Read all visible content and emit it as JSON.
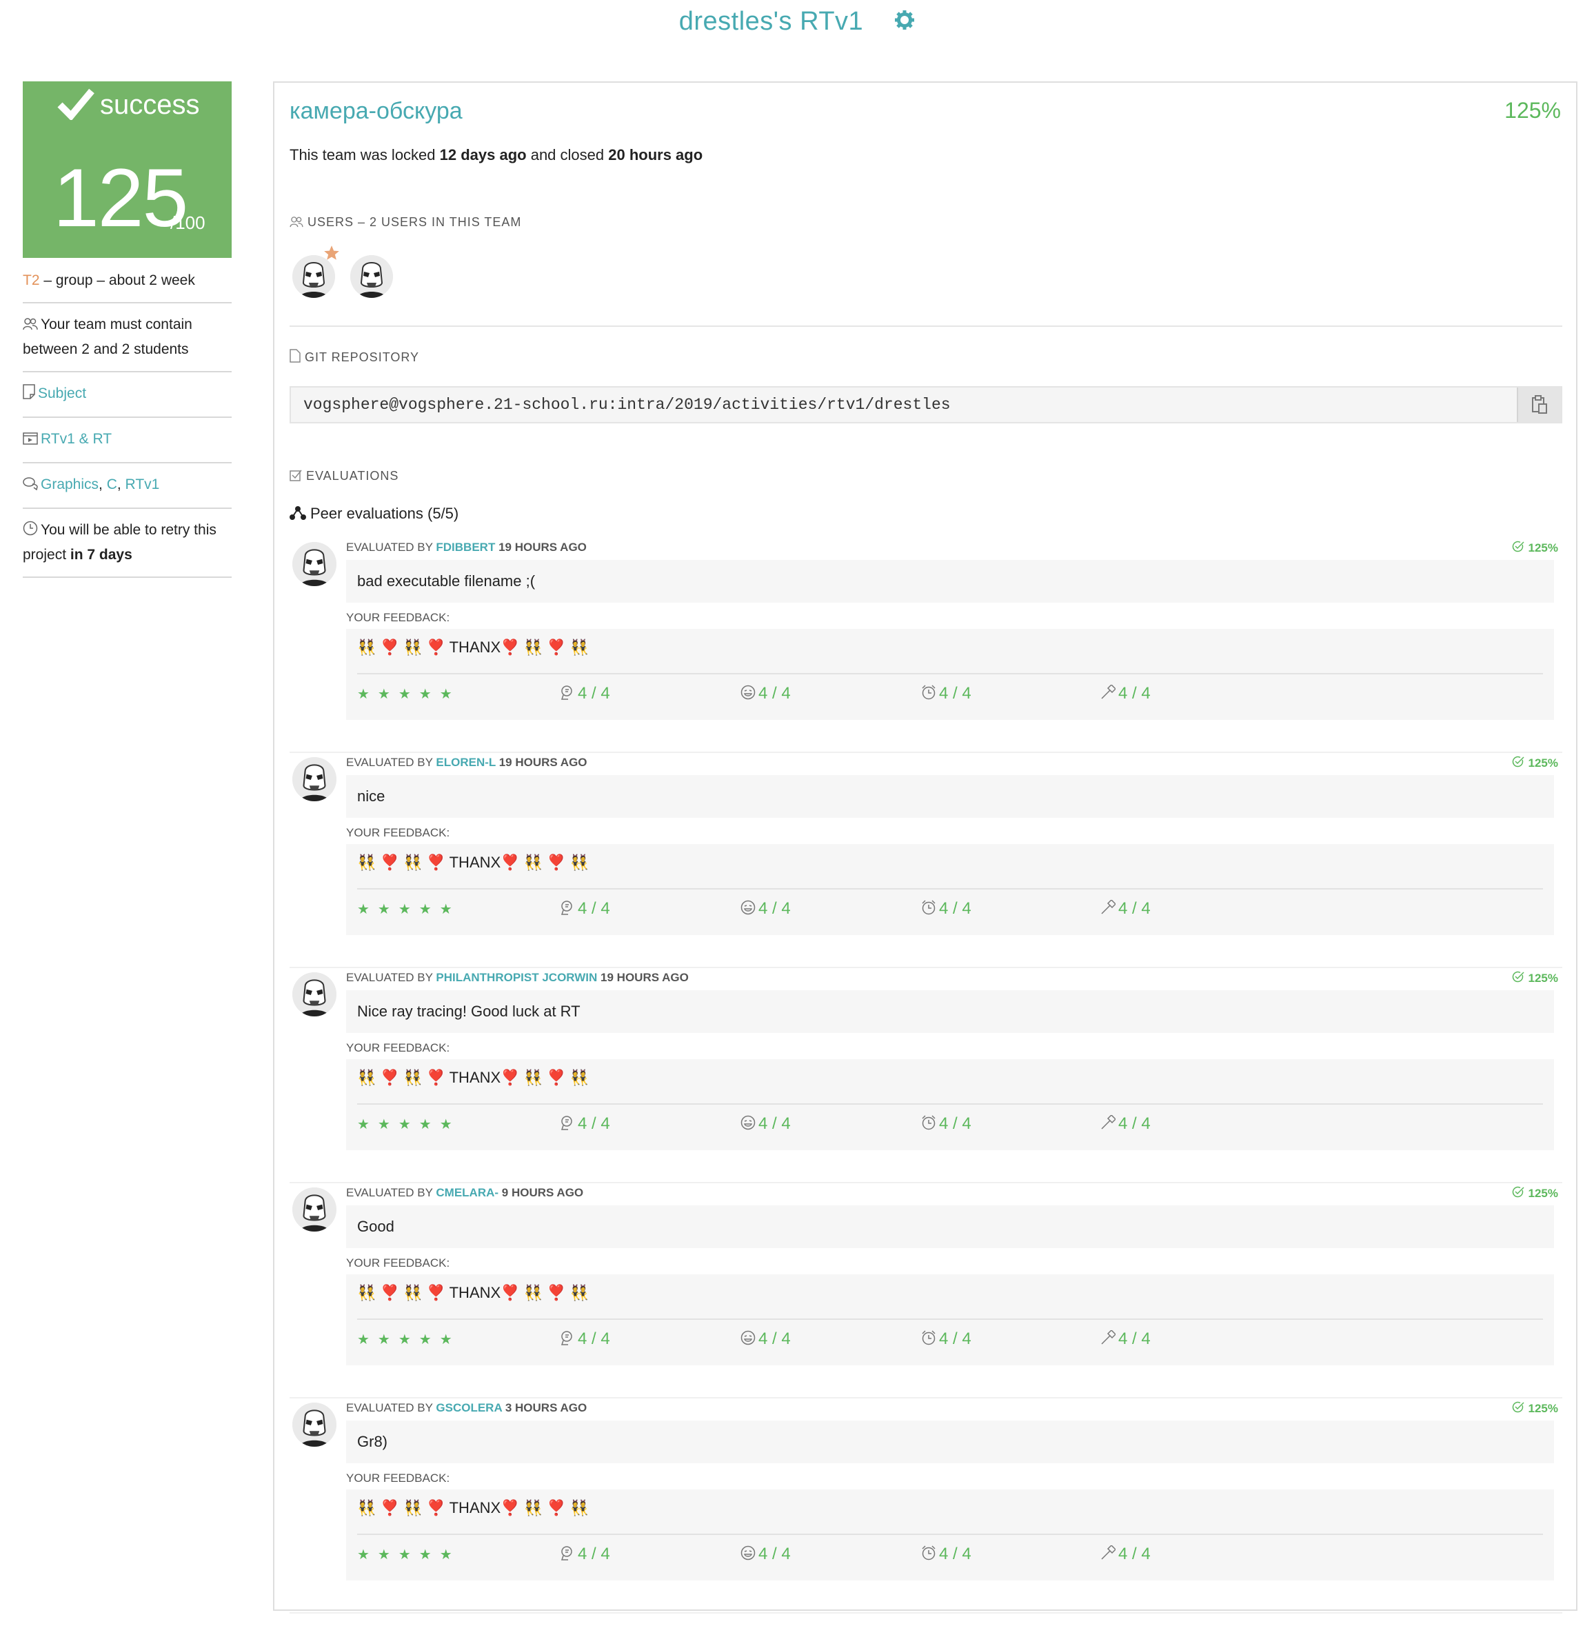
{
  "header": {
    "title": "drestles's RTv1",
    "settings_icon": "gear-icon"
  },
  "sidebar": {
    "status": "success",
    "score": "125",
    "score_max": "/100",
    "tier": "T2",
    "tier_meta": " – group – about 2 week",
    "team_rule": "Your team must contain between 2 and 2 students",
    "subject_link": "Subject",
    "video_link": "RTv1 & RT",
    "tags": [
      "Graphics",
      "C",
      "RTv1"
    ],
    "retry_prefix": "You will be able to retry this project ",
    "retry_bold": "in 7 days"
  },
  "main": {
    "project_name": "камера-обскура",
    "project_pct": "125%",
    "locked_prefix": "This team was locked ",
    "locked_when": "12 days ago",
    "closed_prefix": " and closed ",
    "closed_when": "20 hours ago",
    "users_label": "USERS – 2 USERS IN THIS TEAM",
    "git_label": "GIT REPOSITORY",
    "git_url": "vogsphere@vogsphere.21-school.ru:intra/2019/activities/rtv1/drestles",
    "evaluations_label": "EVALUATIONS",
    "peer_title": "Peer evaluations (5/5)"
  },
  "evaluations": [
    {
      "prefix": "EVALUATED BY ",
      "login": "FDIBBERT",
      "ago": " 19 HOURS AGO",
      "pct": "125%",
      "comment": "bad executable filename ;(",
      "feedback_label": "YOUR FEEDBACK:",
      "feedback": "👯 ❣️ 👯 ❣️ THANX❣️ 👯 ❣️ 👯",
      "stars": "★★★★★",
      "scores": [
        "4 / 4",
        "4 / 4",
        "4 / 4",
        "4 / 4"
      ]
    },
    {
      "prefix": "EVALUATED BY ",
      "login": "ELOREN-L",
      "ago": " 19 HOURS AGO",
      "pct": "125%",
      "comment": "nice",
      "feedback_label": "YOUR FEEDBACK:",
      "feedback": "👯 ❣️ 👯 ❣️ THANX❣️ 👯 ❣️ 👯",
      "stars": "★★★★★",
      "scores": [
        "4 / 4",
        "4 / 4",
        "4 / 4",
        "4 / 4"
      ]
    },
    {
      "prefix": "EVALUATED BY ",
      "login": "PHILANTHROPIST JCORWIN",
      "ago": " 19 HOURS AGO",
      "pct": "125%",
      "comment": "Nice ray tracing! Good luck at RT",
      "feedback_label": "YOUR FEEDBACK:",
      "feedback": "👯 ❣️ 👯 ❣️ THANX❣️ 👯 ❣️ 👯",
      "stars": "★★★★★",
      "scores": [
        "4 / 4",
        "4 / 4",
        "4 / 4",
        "4 / 4"
      ]
    },
    {
      "prefix": "EVALUATED BY ",
      "login": "CMELARA-",
      "ago": " 9 HOURS AGO",
      "pct": "125%",
      "comment": "Good",
      "feedback_label": "YOUR FEEDBACK:",
      "feedback": "👯 ❣️ 👯 ❣️ THANX❣️ 👯 ❣️ 👯",
      "stars": "★★★★★",
      "scores": [
        "4 / 4",
        "4 / 4",
        "4 / 4",
        "4 / 4"
      ]
    },
    {
      "prefix": "EVALUATED BY ",
      "login": "GSCOLERA",
      "ago": " 3 HOURS AGO",
      "pct": "125%",
      "comment": "Gr8)",
      "feedback_label": "YOUR FEEDBACK:",
      "feedback": "👯 ❣️ 👯 ❣️ THANX❣️ 👯 ❣️ 👯",
      "stars": "★★★★★",
      "scores": [
        "4 / 4",
        "4 / 4",
        "4 / 4",
        "4 / 4"
      ]
    }
  ],
  "colors": {
    "teal": "#47a9b1",
    "green": "#5cb85c",
    "success_bg": "#75b568",
    "orange": "#e3925a"
  }
}
